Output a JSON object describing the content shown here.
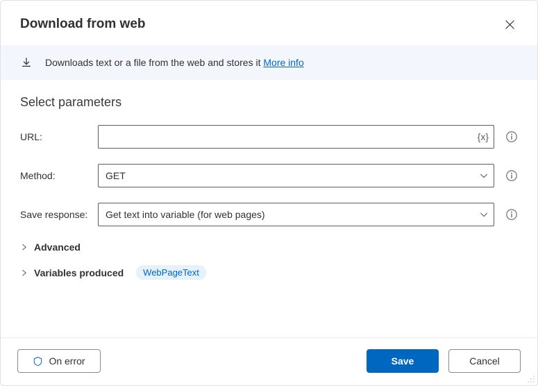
{
  "title": "Download from web",
  "banner": {
    "text": "Downloads text or a file from the web and stores it ",
    "link": "More info"
  },
  "section_title": "Select parameters",
  "fields": {
    "url": {
      "label": "URL:",
      "value": "",
      "suffix": "{x}"
    },
    "method": {
      "label": "Method:",
      "value": "GET"
    },
    "save_response": {
      "label": "Save response:",
      "value": "Get text into variable (for web pages)"
    }
  },
  "expanders": {
    "advanced": "Advanced",
    "variables_produced": "Variables produced"
  },
  "variable_chip": "WebPageText",
  "footer": {
    "on_error": "On error",
    "save": "Save",
    "cancel": "Cancel"
  }
}
